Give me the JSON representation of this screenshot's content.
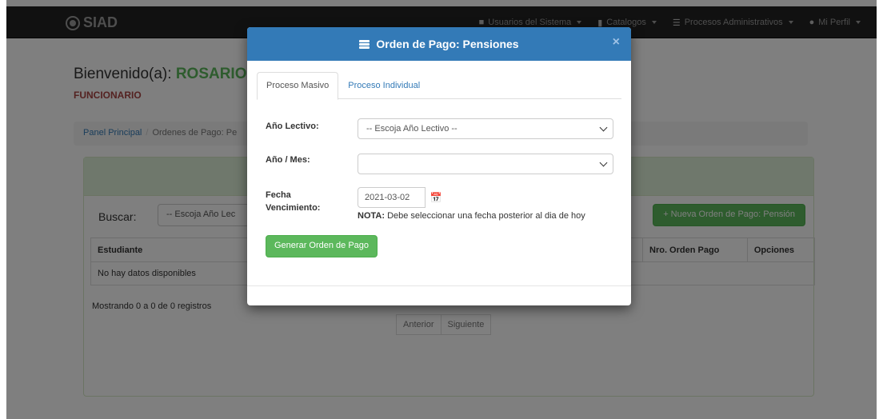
{
  "navbar": {
    "brand": "SIAD",
    "items": [
      {
        "label": "Usuarios del Sistema",
        "icon": "lock-icon"
      },
      {
        "label": "Catalogos",
        "icon": "file-icon"
      },
      {
        "label": "Procesos Administrativos",
        "icon": "list-icon"
      },
      {
        "label": "Mi Perfil",
        "icon": "user-icon"
      }
    ]
  },
  "welcome": {
    "greeting": "Bienvenido(a):",
    "name": "ROSARIO",
    "role": "FUNCIONARIO"
  },
  "breadcrumb": {
    "home": "Panel Principal",
    "current": "Ordenes de Pago: Pe"
  },
  "panel": {
    "search_label": "Buscar:",
    "search_select": "-- Escoja Año Lec",
    "new_button": "Nueva Orden de Pago: Pensión",
    "columns": [
      "Estudiante",
      "Nro. Orden Pago",
      "Opciones"
    ],
    "empty": "No hay datos disponibles",
    "info": "Mostrando 0 a 0 de 0 registros",
    "prev": "Anterior",
    "next": "Siguiente"
  },
  "modal": {
    "title": "Orden de Pago: Pensiones",
    "close": "×",
    "tabs": [
      "Proceso Masivo",
      "Proceso Individual"
    ],
    "anio_lectivo_label": "Año Lectivo:",
    "anio_lectivo_value": "-- Escoja Año Lectivo --",
    "anio_mes_label": "Año / Mes:",
    "anio_mes_value": "",
    "fecha_label_1": "Fecha",
    "fecha_label_2": "Vencimiento:",
    "fecha_value": "2021-03-02",
    "note_bold": "NOTA:",
    "note_text": " Debe seleccionar una fecha posterior al dia de hoy",
    "generate_button": "Generar Orden de Pago"
  },
  "colors": {
    "primary": "#337ab7",
    "success": "#5cb85c",
    "danger": "#a94442",
    "navbar": "#222222"
  }
}
